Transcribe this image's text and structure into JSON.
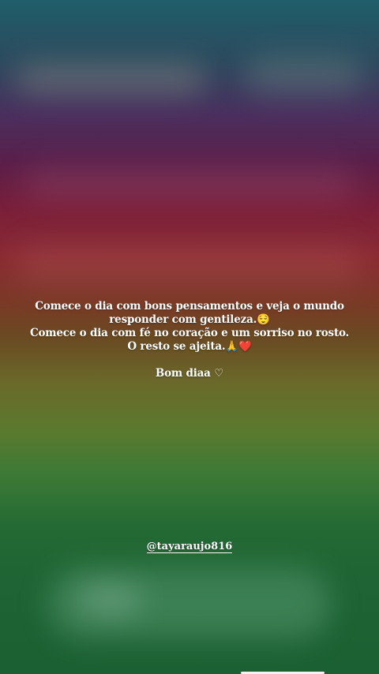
{
  "story": {
    "caption_lines": [
      "Comece o dia com bons pensamentos e veja o mundo",
      "responder com gentileza.😌",
      "Comece o dia com fé no coração e um sorriso no rosto.",
      "O resto se ajeita.🙏❤️"
    ],
    "greeting": "Bom diaa ♡",
    "mention": "@tayaraujo816"
  }
}
